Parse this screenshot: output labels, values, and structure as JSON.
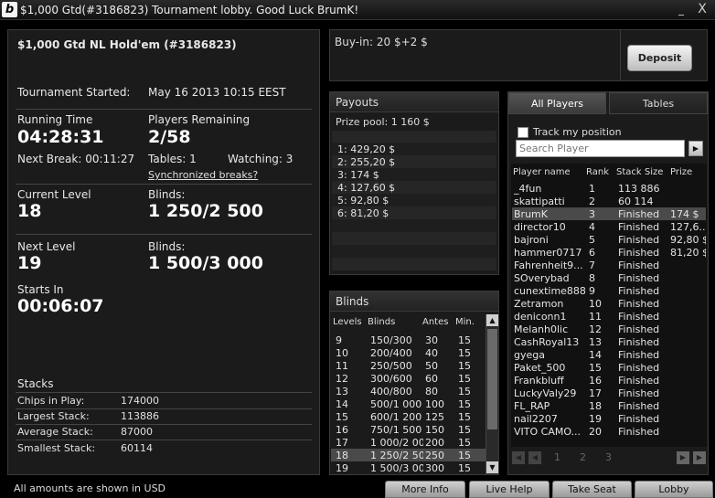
{
  "window": {
    "title": "$1,000 Gtd(#3186823) Tournament lobby. Good Luck BrumK!",
    "logo": "b",
    "minimize": "_",
    "close": "X"
  },
  "info": {
    "name": "$1,000 Gtd NL Hold'em (#3186823)",
    "started_label": "Tournament Started:",
    "started_value": "May 16 2013  10:15 EEST",
    "running_label": "Running Time",
    "running_value": "04:28:31",
    "remaining_label": "Players Remaining",
    "remaining_value": "2/58",
    "next_break": "Next Break: 00:11:27",
    "tables": "Tables: 1",
    "watching": "Watching: 3",
    "sync_link": "Synchronized breaks?",
    "current_level_label": "Current Level",
    "current_level_value": "18",
    "current_blinds_label": "Blinds:",
    "current_blinds_value": "1 250/2 500",
    "next_level_label": "Next Level",
    "next_level_value": "19",
    "next_blinds_label": "Blinds:",
    "next_blinds_value": "1 500/3 000",
    "starts_in_label": "Starts In",
    "starts_in_value": "00:06:07",
    "stacks_label": "Stacks",
    "stacks": [
      {
        "label": "Chips in Play:",
        "value": "174000"
      },
      {
        "label": "Largest Stack:",
        "value": "113886"
      },
      {
        "label": "Average Stack:",
        "value": "87000"
      },
      {
        "label": "Smallest Stack:",
        "value": "60114"
      }
    ]
  },
  "buyin": {
    "text": "Buy-in: 20 $+2 $",
    "deposit_label": "Deposit"
  },
  "payouts": {
    "title": "Payouts",
    "prize_pool": "Prize pool: 1 160 $",
    "rows": [
      "1: 429,20 $",
      "2: 255,20 $",
      "3: 174 $",
      "4: 127,60 $",
      "5: 92,80 $",
      "6: 81,20 $"
    ]
  },
  "blinds": {
    "title": "Blinds",
    "headers": {
      "levels": "Levels",
      "blinds": "Blinds",
      "antes": "Antes",
      "min": "Min."
    },
    "rows": [
      {
        "level": "9",
        "blinds": "150/300",
        "antes": "30",
        "min": "15"
      },
      {
        "level": "10",
        "blinds": "200/400",
        "antes": "40",
        "min": "15"
      },
      {
        "level": "11",
        "blinds": "250/500",
        "antes": "50",
        "min": "15"
      },
      {
        "level": "12",
        "blinds": "300/600",
        "antes": "60",
        "min": "15"
      },
      {
        "level": "13",
        "blinds": "400/800",
        "antes": "80",
        "min": "15"
      },
      {
        "level": "14",
        "blinds": "500/1 000",
        "antes": "100",
        "min": "15"
      },
      {
        "level": "15",
        "blinds": "600/1 200",
        "antes": "125",
        "min": "15"
      },
      {
        "level": "16",
        "blinds": "750/1 500",
        "antes": "150",
        "min": "15"
      },
      {
        "level": "17",
        "blinds": "1 000/2 000",
        "antes": "200",
        "min": "15"
      },
      {
        "level": "18",
        "blinds": "1 250/2 500",
        "antes": "250",
        "min": "15"
      },
      {
        "level": "19",
        "blinds": "1 500/3 000",
        "antes": "300",
        "min": "15"
      }
    ]
  },
  "players": {
    "tab_all": "All Players",
    "tab_tables": "Tables",
    "track_label": "Track my position",
    "search_placeholder": "Search Player",
    "headers": {
      "name": "Player name",
      "rank": "Rank",
      "stack": "Stack Size",
      "prize": "Prize"
    },
    "rows": [
      {
        "name": "_4fun",
        "rank": "1",
        "stack": "113 886",
        "prize": ""
      },
      {
        "name": "skattipatti",
        "rank": "2",
        "stack": "60 114",
        "prize": ""
      },
      {
        "name": "BrumK",
        "rank": "3",
        "stack": "Finished",
        "prize": "174 $"
      },
      {
        "name": "director10",
        "rank": "4",
        "stack": "Finished",
        "prize": "127,6..."
      },
      {
        "name": "bajroni",
        "rank": "5",
        "stack": "Finished",
        "prize": "92,80 $"
      },
      {
        "name": "hammer0717",
        "rank": "6",
        "stack": "Finished",
        "prize": "81,20 $"
      },
      {
        "name": "Fahrenheit9...",
        "rank": "7",
        "stack": "Finished",
        "prize": ""
      },
      {
        "name": "SOverybad",
        "rank": "8",
        "stack": "Finished",
        "prize": ""
      },
      {
        "name": "cunextime888",
        "rank": "9",
        "stack": "Finished",
        "prize": ""
      },
      {
        "name": "Zetramon",
        "rank": "10",
        "stack": "Finished",
        "prize": ""
      },
      {
        "name": "deniconn1",
        "rank": "11",
        "stack": "Finished",
        "prize": ""
      },
      {
        "name": "Melanh0lic",
        "rank": "12",
        "stack": "Finished",
        "prize": ""
      },
      {
        "name": "CashRoyal13",
        "rank": "13",
        "stack": "Finished",
        "prize": ""
      },
      {
        "name": "gyega",
        "rank": "14",
        "stack": "Finished",
        "prize": ""
      },
      {
        "name": "Paket_500",
        "rank": "15",
        "stack": "Finished",
        "prize": ""
      },
      {
        "name": "Frankbluff",
        "rank": "16",
        "stack": "Finished",
        "prize": ""
      },
      {
        "name": "LuckyValy29",
        "rank": "17",
        "stack": "Finished",
        "prize": ""
      },
      {
        "name": "FL_RAP",
        "rank": "18",
        "stack": "Finished",
        "prize": ""
      },
      {
        "name": "nail2207",
        "rank": "19",
        "stack": "Finished",
        "prize": ""
      },
      {
        "name": "VITO CAMO...",
        "rank": "20",
        "stack": "Finished",
        "prize": ""
      }
    ],
    "pages": [
      "1",
      "2",
      "3"
    ]
  },
  "footer": {
    "note": "All amounts are shown in USD",
    "buttons": [
      "More Info",
      "Live Help",
      "Take Seat",
      "Lobby"
    ]
  }
}
